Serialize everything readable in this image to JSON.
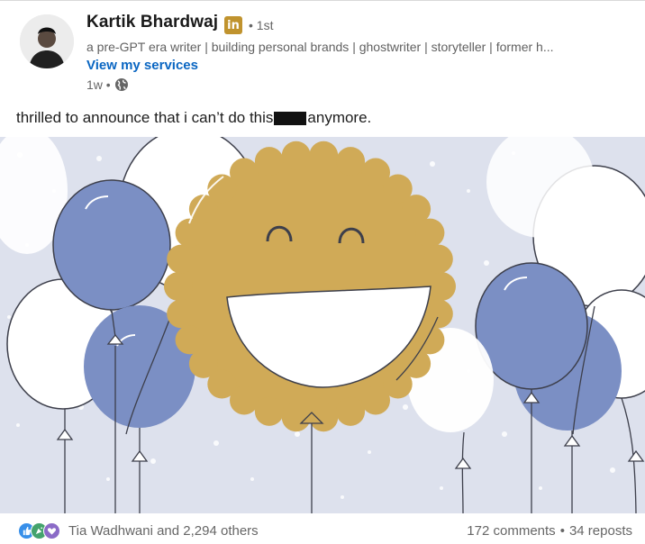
{
  "author": {
    "name": "Kartik Bhardwaj",
    "badge": "in",
    "degree": "• 1st",
    "headline": "a pre-GPT era writer | building personal brands | ghostwriter | storyteller | former h...",
    "services_link": "View my services",
    "time": "1w •",
    "visibility_icon": "globe-icon"
  },
  "post": {
    "text_before": "thrilled to announce that i can’t do this",
    "text_after": "anymore.",
    "image": {
      "subject": "smiling-gold-balloon-with-blue-and-white-balloons",
      "colors": {
        "background": "#dde1ed",
        "blue": "#7b8fc4",
        "gold": "#d0aa57",
        "outline": "#3d3f4b"
      }
    }
  },
  "footer": {
    "reactions": [
      "like-icon",
      "celebrate-icon",
      "support-icon"
    ],
    "likers": "Tia Wadhwani and 2,294 others",
    "comments": "172 comments",
    "separator": "•",
    "reposts": "34 reposts"
  },
  "colors": {
    "link": "#0a66c2",
    "badge": "#c0932e"
  }
}
